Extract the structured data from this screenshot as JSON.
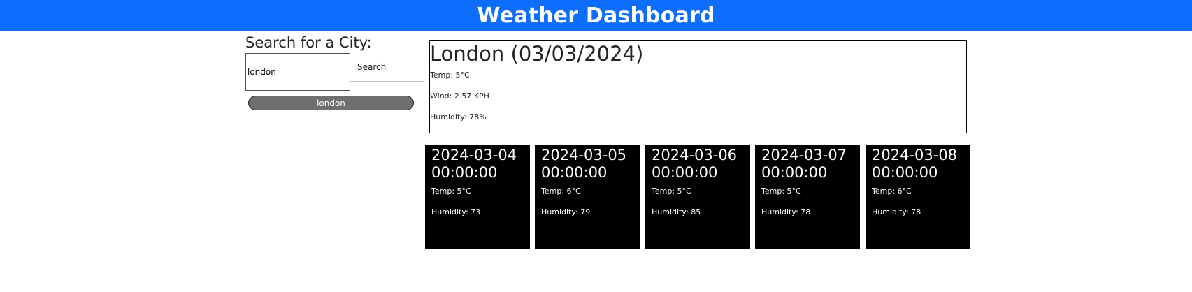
{
  "header": {
    "title": "Weather Dashboard"
  },
  "search": {
    "heading": "Search for a City:",
    "input_value": "london",
    "button_label": "Search",
    "history": [
      "london"
    ]
  },
  "current": {
    "title": "London (03/03/2024)",
    "temp": "Temp: 5°C",
    "wind": "Wind: 2.57 KPH",
    "humidity": "Humidity: 78%"
  },
  "forecast": [
    {
      "date": "2024-03-04",
      "time": "00:00:00",
      "temp": "Temp: 5°C",
      "humidity": "Humidity: 73"
    },
    {
      "date": "2024-03-05",
      "time": "00:00:00",
      "temp": "Temp: 6°C",
      "humidity": "Humidity: 79"
    },
    {
      "date": "2024-03-06",
      "time": "00:00:00",
      "temp": "Temp: 5°C",
      "humidity": "Humidity: 85"
    },
    {
      "date": "2024-03-07",
      "time": "00:00:00",
      "temp": "Temp: 5°C",
      "humidity": "Humidity: 78"
    },
    {
      "date": "2024-03-08",
      "time": "00:00:00",
      "temp": "Temp: 6°C",
      "humidity": "Humidity: 78"
    }
  ],
  "colors": {
    "header_bg": "#0d6efd",
    "history_button_bg": "#6f6f6f",
    "forecast_card_bg": "#000000"
  }
}
